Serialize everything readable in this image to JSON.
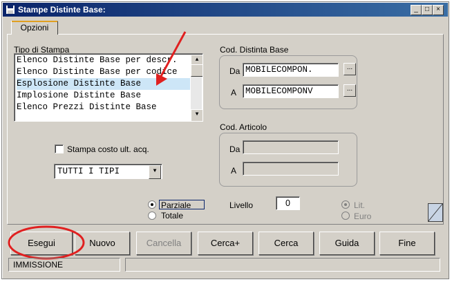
{
  "window": {
    "title": "Stampe Distinte Base:",
    "controls": [
      "_",
      "□",
      "×"
    ]
  },
  "tabs": [
    {
      "label": "Opzioni"
    }
  ],
  "tipo_stampa": {
    "label": "Tipo di Stampa",
    "items": [
      "Elenco Distinte Base per descr.",
      "Elenco Distinte Base per codice",
      "Esplosione Distinte Base",
      "Implosione Distinte Base",
      "Elenco Prezzi Distinte Base"
    ],
    "selected": "Esplosione Distinte Base"
  },
  "cod_distinta": {
    "label": "Cod. Distinta Base",
    "da_label": "Da",
    "a_label": "A",
    "da_value": "MOBILECOMPON.",
    "a_value": "MOBILECOMPONV",
    "browse": "..."
  },
  "cod_articolo": {
    "label": "Cod. Articolo",
    "da_label": "Da",
    "a_label": "A",
    "da_value": "",
    "a_value": ""
  },
  "stampa_costo": {
    "label": "Stampa costo ult. acq.",
    "checked": false
  },
  "tipo_combo": {
    "value": "TUTTI I TIPI"
  },
  "mode": {
    "parziale": "Parziale",
    "totale": "Totale",
    "selected": "Parziale"
  },
  "livello": {
    "label": "Livello",
    "value": "0"
  },
  "currency": {
    "lit": "Lit.",
    "euro": "Euro",
    "selected": "Lit."
  },
  "buttons": {
    "esegui": "Esegui",
    "nuovo": "Nuovo",
    "cancella": "Cancella",
    "cerca_plus": "Cerca+",
    "cerca": "Cerca",
    "guida": "Guida",
    "fine": "Fine"
  },
  "status": {
    "left": "IMMISSIONE",
    "right": ""
  },
  "annotation": {
    "color": "#e02020"
  }
}
